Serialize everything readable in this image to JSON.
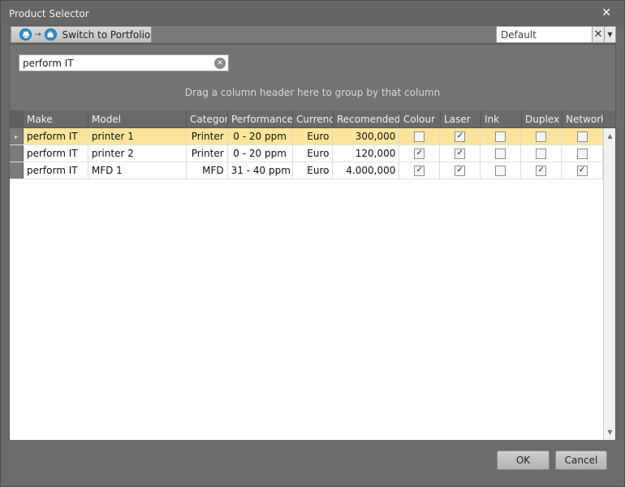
{
  "window": {
    "title": "Product Selector",
    "close_glyph": "✕"
  },
  "toolbar": {
    "switch_label": "Switch to Portfolio",
    "arrow": "→",
    "combo_value": "Default",
    "combo_clear": "✕",
    "combo_drop": "▼"
  },
  "search": {
    "value": "perform IT",
    "clear_glyph": "✕"
  },
  "grid": {
    "group_hint": "Drag a column header here to group by that column",
    "columns": [
      "Make",
      "Model",
      "Category",
      "Performance",
      "Currency",
      "Recomended",
      "Colour",
      "Laser",
      "Ink",
      "Duplex",
      "Network"
    ],
    "rows": [
      {
        "make": "perform IT",
        "model": "printer 1",
        "category": "Printer",
        "performance": "0  - 20 ppm",
        "currency": "Euro",
        "recommended": "300,000",
        "colour": false,
        "laser": true,
        "ink": false,
        "duplex": false,
        "network": false,
        "selected": true
      },
      {
        "make": "perform IT",
        "model": "printer 2",
        "category": "Printer",
        "performance": "0  - 20 ppm",
        "currency": "Euro",
        "recommended": "120,000",
        "colour": true,
        "laser": true,
        "ink": false,
        "duplex": false,
        "network": false,
        "selected": false
      },
      {
        "make": "perform IT",
        "model": "MFD 1",
        "category": "MFD",
        "performance": "31 - 40 ppm",
        "currency": "Euro",
        "recommended": "4.000,000",
        "colour": true,
        "laser": true,
        "ink": false,
        "duplex": true,
        "network": true,
        "selected": false
      }
    ],
    "row_indicator": "▸",
    "check_glyph": "✓"
  },
  "footer": {
    "ok_label": "OK",
    "cancel_label": "Cancel"
  },
  "colors": {
    "selected_row": "#fbe59c",
    "accent_icon": "#2a8fd0"
  }
}
